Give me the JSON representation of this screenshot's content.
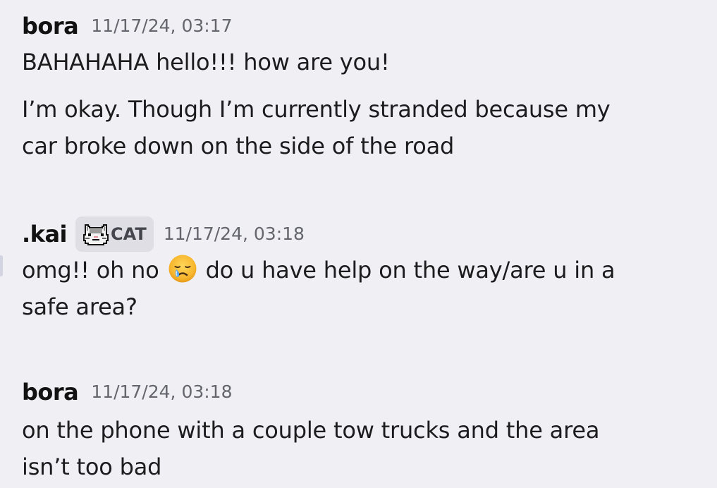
{
  "messages": [
    {
      "author": "bora",
      "timestamp": "11/17/24, 03:17",
      "lines": [
        "BAHAHAHA hello!!! how are you!",
        "I’m okay. Though I’m currently stranded because my",
        "car broke down on the side of the road"
      ]
    },
    {
      "author": ".kai",
      "role_badge": {
        "icon": "cat-icon",
        "label": "CAT"
      },
      "timestamp": "11/17/24, 03:18",
      "lines": [
        "omg!! oh no",
        "do u have help on the way/are u in a",
        "safe area?"
      ],
      "emoji": "crying-face-emoji"
    },
    {
      "author": "bora",
      "timestamp": "11/17/24, 03:18",
      "lines": [
        "on the phone with a couple tow trucks and the area",
        "isn’t too bad"
      ]
    }
  ],
  "colors": {
    "background": "#efeff4",
    "username": "#121212",
    "timestamp": "#65656d",
    "message": "#1c1c1e",
    "badge_bg": "#dedee4",
    "badge_text": "#45454d"
  }
}
